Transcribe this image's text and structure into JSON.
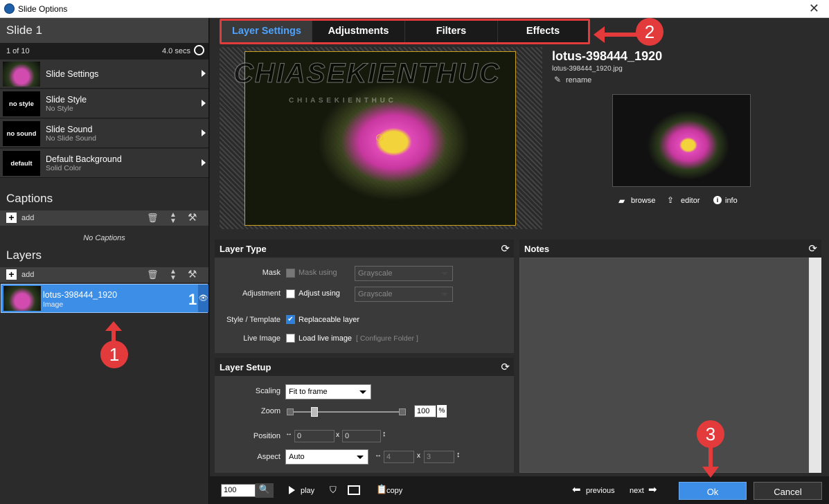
{
  "window": {
    "title": "Slide Options",
    "close_glyph": "✕"
  },
  "slide": {
    "title": "Slide 1",
    "position": "1 of 10",
    "duration": "4.0 secs",
    "items": [
      {
        "label": "Slide Settings",
        "sub": "",
        "thumb": ""
      },
      {
        "label": "Slide Style",
        "sub": "No Style",
        "thumb": "no style"
      },
      {
        "label": "Slide Sound",
        "sub": "No Slide Sound",
        "thumb": "no sound"
      },
      {
        "label": "Default Background",
        "sub": "Solid Color",
        "thumb": "default"
      }
    ]
  },
  "captions": {
    "title": "Captions",
    "add_label": "add",
    "empty_text": "No Captions"
  },
  "layers": {
    "title": "Layers",
    "add_label": "add",
    "items": [
      {
        "name": "lotus-398444_1920",
        "type": "Image",
        "number": "1"
      }
    ]
  },
  "tabs": [
    {
      "label": "Layer Settings",
      "active": true
    },
    {
      "label": "Adjustments",
      "active": false
    },
    {
      "label": "Filters",
      "active": false
    },
    {
      "label": "Effects",
      "active": false
    }
  ],
  "markers": [
    "1",
    "2",
    "3"
  ],
  "preview": {
    "watermark": "CHIASEKIENTHUC",
    "watermark_sub": "C H I A S E K I E N T H U C"
  },
  "file": {
    "title": "lotus-398444_1920",
    "filename": "lotus-398444_1920.jpg",
    "rename_label": "rename",
    "browse_label": "browse",
    "editor_label": "editor",
    "info_label": "info"
  },
  "layer_type": {
    "title": "Layer Type",
    "mask_label": "Mask",
    "mask_check_label": "Mask using",
    "mask_select": "Grayscale",
    "adjustment_label": "Adjustment",
    "adjust_check_label": "Adjust using",
    "adjust_select": "Grayscale",
    "style_label": "Style / Template",
    "replaceable_label": "Replaceable layer",
    "live_label": "Live Image",
    "live_check_label": "Load live image",
    "configure_label": "[ Configure Folder ]"
  },
  "layer_setup": {
    "title": "Layer Setup",
    "scaling_label": "Scaling",
    "scaling_value": "Fit to frame",
    "zoom_label": "Zoom",
    "zoom_value": "100",
    "zoom_unit": "%",
    "zoom_fraction": 0.2,
    "position_label": "Position",
    "pos_x": "0",
    "pos_y": "0",
    "x_label": "x",
    "aspect_label": "Aspect",
    "aspect_value": "Auto",
    "aspect_w": "4",
    "aspect_h": "3"
  },
  "notes": {
    "title": "Notes"
  },
  "bottom": {
    "zoom_value": "100",
    "play_label": "play",
    "copy_label": "copy",
    "previous_label": "previous",
    "next_label": "next",
    "ok_label": "Ok",
    "cancel_label": "Cancel"
  },
  "colors": {
    "accent": "#2f80d8",
    "selected": "#3d8ee6",
    "marker": "#e33b3b",
    "tab_active": "#4da3ff"
  }
}
